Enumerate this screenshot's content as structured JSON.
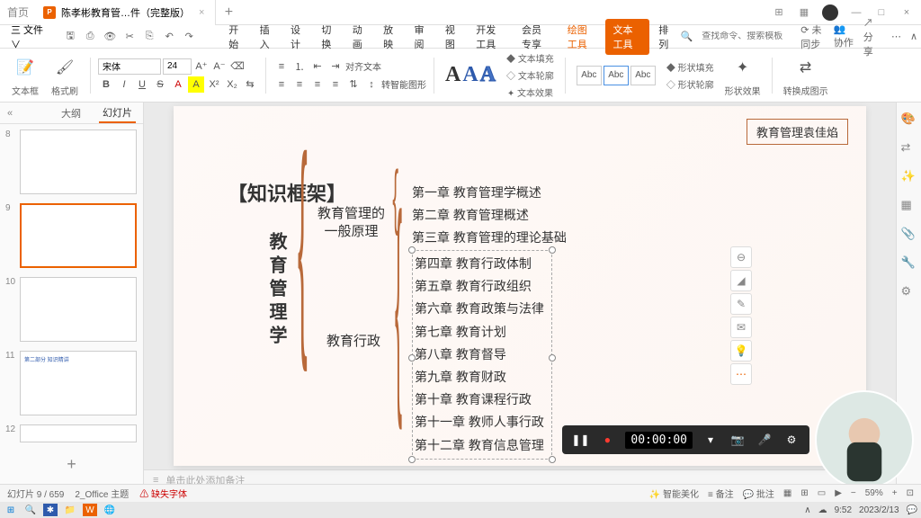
{
  "titlebar": {
    "home_tab": "首页",
    "doc_icon": "P",
    "doc_name": "陈孝彬教育管…件（完整版）",
    "add": "+"
  },
  "menubar": {
    "file": "三 文件 ∨",
    "tabs": [
      "开始",
      "插入",
      "设计",
      "切换",
      "动画",
      "放映",
      "审阅",
      "视图",
      "开发工具",
      "会员专享",
      "绘图工具",
      "文本工具",
      "排列"
    ],
    "accent_idx": 10,
    "active_idx": 11,
    "search_placeholder": "查找命令、搜索模板",
    "right": [
      "未同步",
      "协作",
      "分享"
    ]
  },
  "ribbon": {
    "textbox": "文本框",
    "format_painter": "格式刷",
    "font_name": "宋体",
    "font_size": "24",
    "align_label": "对齐文本",
    "wordart_label": "转智能图形",
    "textfill": "文本填充",
    "textoutline": "文本轮廓",
    "texteffect": "文本效果",
    "style_sample": "Abc",
    "shapefill": "形状填充",
    "shapeoutline": "形状轮廓",
    "shapeeffect": "形状效果",
    "convert": "转换成图示"
  },
  "outline": {
    "tab_outline": "大纲",
    "tab_slides": "幻灯片",
    "thumbs": [
      {
        "num": "8"
      },
      {
        "num": "9"
      },
      {
        "num": "10"
      },
      {
        "num": "11",
        "text": "第二部分  知识精讲"
      },
      {
        "num": "12"
      }
    ]
  },
  "slide": {
    "tag": "教育管理袁佳焰",
    "title": "【知识框架】",
    "main": "教育管理学",
    "sub1": "教育管理的\n一般原理",
    "sub2": "教育行政",
    "group1": [
      "第一章  教育管理学概述",
      "第二章  教育管理概述",
      "第三章  教育管理的理论基础"
    ],
    "group2": [
      "第四章  教育行政体制",
      "第五章  教育行政组织",
      "第六章  教育政策与法律",
      "第七章  教育计划",
      "第八章  教育督导",
      "第九章  教育财政",
      "第十章  教育课程行政",
      "第十一章  教师人事行政",
      "第十二章  教育信息管理"
    ]
  },
  "notes": "单击此处添加备注",
  "recorder": {
    "time": "00:00:00"
  },
  "status": {
    "slide_pos": "幻灯片 9 / 659",
    "theme": "2_Office 主题",
    "font_warn": "缺失字体",
    "ai": "智能美化",
    "notes_btn": "备注",
    "comment": "批注",
    "zoom": "59%"
  },
  "taskbar": {
    "time": "9:52",
    "date": "2023/2/13"
  }
}
